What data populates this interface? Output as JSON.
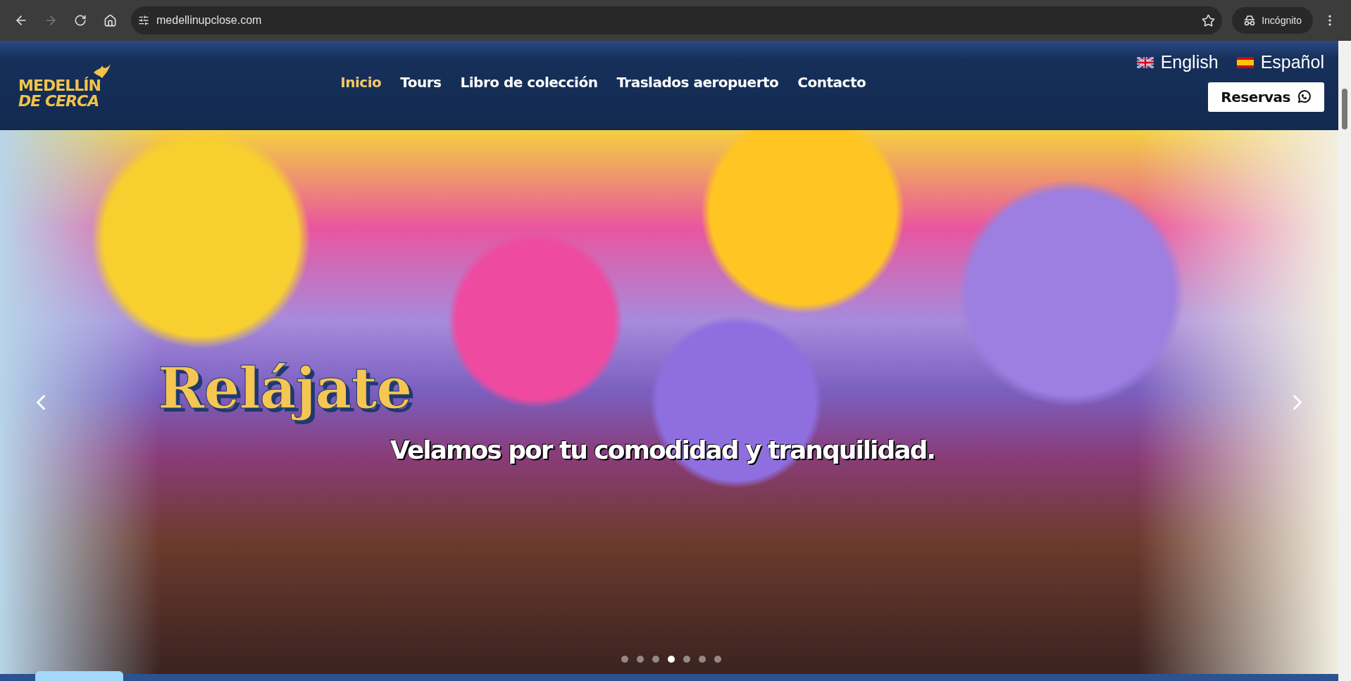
{
  "browser": {
    "url": "medellinupclose.com",
    "profile": "Incógnito"
  },
  "header": {
    "logo": [
      "MEDELLÍN",
      "DE CERCA"
    ],
    "nav": [
      {
        "label": "Inicio",
        "selected": true
      },
      {
        "label": "Tours",
        "selected": false
      },
      {
        "label": "Libro de colección",
        "selected": false
      },
      {
        "label": "Traslados aeropuerto",
        "selected": false
      },
      {
        "label": "Contacto",
        "selected": false
      }
    ],
    "languages": [
      {
        "label": "English",
        "kind": "uk"
      },
      {
        "label": "Español",
        "kind": "es"
      }
    ],
    "reserve_button": "Reservas"
  },
  "hero": {
    "title": "Relájate",
    "subtitle": "Velamos por tu comodidad y tranquilidad.",
    "dots": [
      {
        "selected": false
      },
      {
        "selected": false
      },
      {
        "selected": false
      },
      {
        "selected": true
      },
      {
        "selected": false
      },
      {
        "selected": false
      },
      {
        "selected": false
      }
    ]
  }
}
